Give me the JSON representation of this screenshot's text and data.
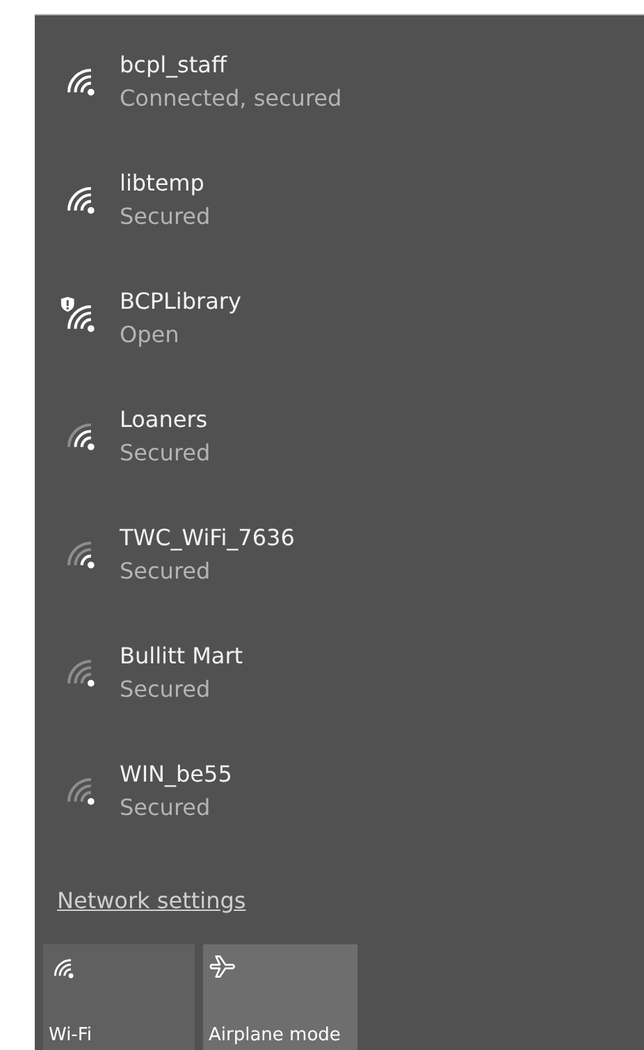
{
  "networks": [
    {
      "name": "bcpl_staff",
      "status": "Connected, secured",
      "kind": "strong"
    },
    {
      "name": "libtemp",
      "status": "Secured",
      "kind": "strong"
    },
    {
      "name": "BCPLibrary",
      "status": "Open",
      "kind": "open"
    },
    {
      "name": "Loaners",
      "status": "Secured",
      "kind": "good"
    },
    {
      "name": "TWC_WiFi_7636",
      "status": "Secured",
      "kind": "fair"
    },
    {
      "name": "Bullitt Mart",
      "status": "Secured",
      "kind": "weak"
    },
    {
      "name": "WIN_be55",
      "status": "Secured",
      "kind": "weak"
    }
  ],
  "settings_link": "Network settings",
  "quick_actions": [
    {
      "label": "Wi-Fi",
      "kind": "wifi"
    },
    {
      "label": "Airplane mode",
      "kind": "airplane"
    }
  ]
}
